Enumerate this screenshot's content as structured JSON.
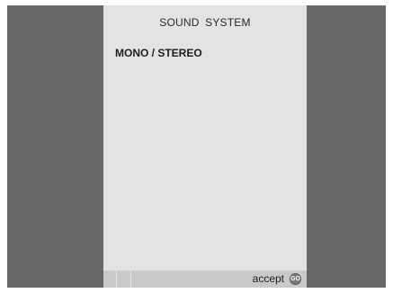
{
  "menu": {
    "title": "SOUND  SYSTEM",
    "items": [
      {
        "label": "MONO / STEREO"
      }
    ]
  },
  "footer": {
    "hint_label": "accept",
    "button": {
      "label": "GO",
      "icon": "go-button-icon"
    }
  },
  "colors": {
    "background": "#68686b",
    "menu_panel": "#e3e3e4",
    "footer_bar": "#c9c9cb",
    "go_button": "#7a7a7d"
  }
}
